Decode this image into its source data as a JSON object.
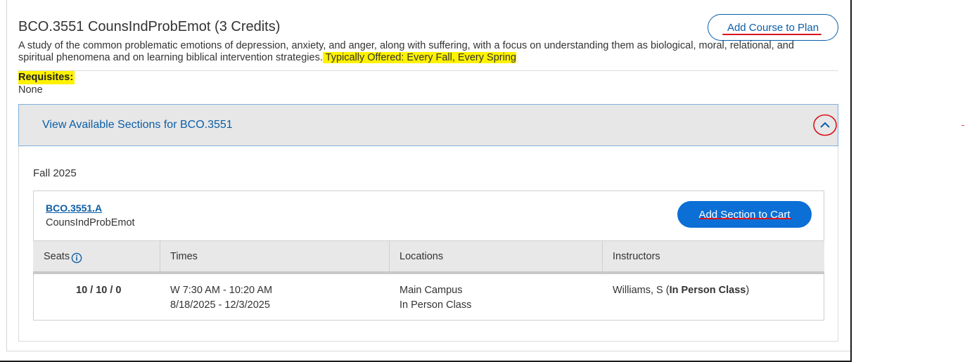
{
  "course": {
    "title": "BCO.3551 CounsIndProbEmot (3 Credits)",
    "add_plan_label": "Add Course to Plan",
    "description_main": "A study of the common problematic emotions of depression, anxiety, and anger, along with suffering, with a focus on understanding them as biological, moral, relational, and spiritual phenomena and on learning biblical intervention strategies.",
    "typically_offered": "Typically Offered: Every Fall, Every Spring",
    "requisites_label": "Requisites:",
    "requisites_value": "None"
  },
  "sections_panel": {
    "header_label": "View Available Sections for BCO.3551",
    "term": "Fall 2025"
  },
  "section": {
    "id": "BCO.3551.A",
    "name": "CounsIndProbEmot",
    "add_cart_label": "Add Section to Cart",
    "columns": [
      "Seats",
      "Times",
      "Locations",
      "Instructors"
    ],
    "row": {
      "seats": "10 / 10 / 0",
      "time_1": "W 7:30 AM - 10:20 AM",
      "time_2": "8/18/2025 - 12/3/2025",
      "location_1": "Main Campus",
      "location_2": "In Person Class",
      "instructor_name": "Williams, S (",
      "instructor_method": "In Person Class",
      "instructor_close": ")"
    }
  },
  "colors": {
    "link_blue": "#0b5ea8",
    "button_blue": "#0b6fd6",
    "highlight_yellow": "#fff200",
    "annotation_red": "#d9141b"
  },
  "icons": {
    "chevron": "chevron-up-icon",
    "info": "info-icon"
  }
}
